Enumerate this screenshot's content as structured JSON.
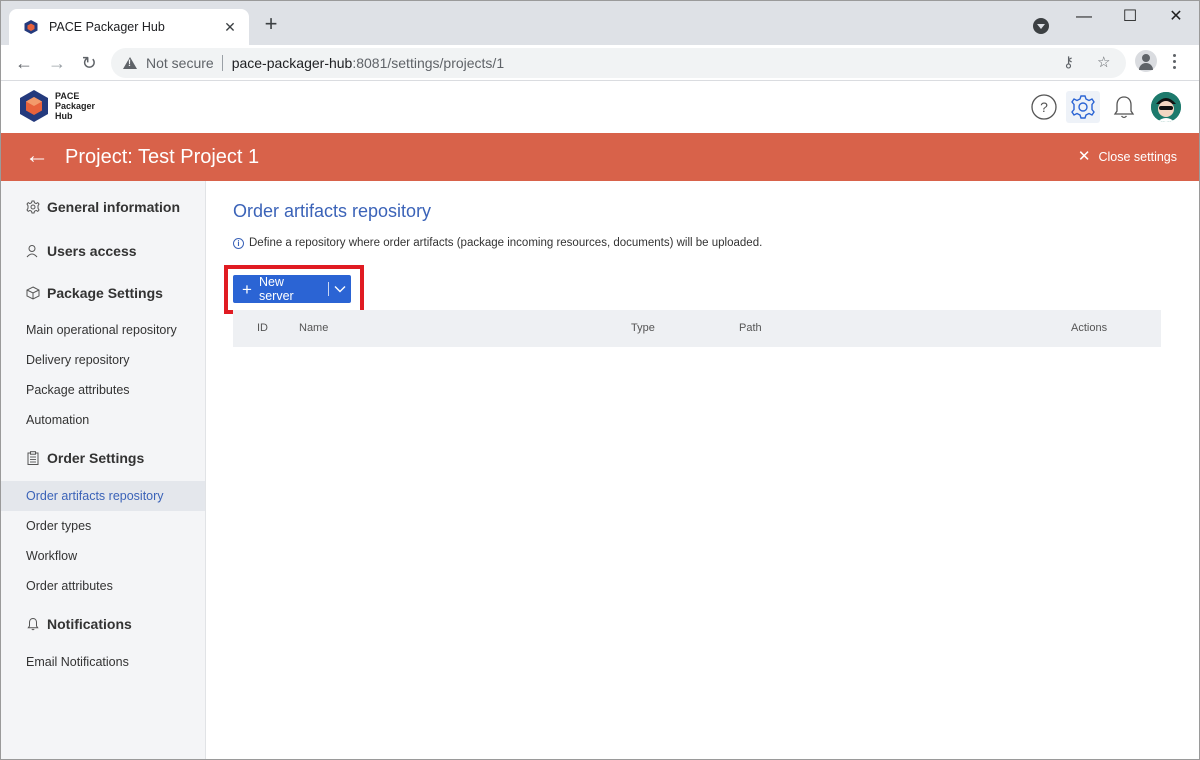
{
  "browser": {
    "tab_title": "PACE Packager Hub",
    "new_tab_glyph": "+",
    "close_tab_glyph": "✕",
    "minimize_glyph": "—",
    "maximize_glyph": "☐",
    "close_glyph": "✕",
    "back_glyph": "←",
    "forward_glyph": "→",
    "reload_glyph": "↻",
    "security_label": "Not secure",
    "url_host": "pace-packager-hub",
    "url_rest": ":8081/settings/projects/1",
    "key_glyph": "⚷",
    "star_glyph": "☆"
  },
  "app": {
    "logo_line1": "PACE",
    "logo_line2": "Packager",
    "logo_line3": "Hub",
    "help_glyph": "?",
    "accent_color": "#d8624a",
    "primary_color": "#2b64d4"
  },
  "banner": {
    "back_glyph": "←",
    "title": "Project: Test Project 1",
    "close_glyph": "✕",
    "close_label": "Close settings"
  },
  "sidebar": {
    "sections": [
      {
        "label": "General information",
        "icon": "gear-icon"
      },
      {
        "label": "Users access",
        "icon": "user-icon"
      },
      {
        "label": "Package Settings",
        "icon": "package-icon"
      },
      {
        "label": "Order Settings",
        "icon": "clipboard-icon"
      },
      {
        "label": "Notifications",
        "icon": "bell-icon"
      }
    ],
    "package_items": [
      "Main operational repository",
      "Delivery repository",
      "Package attributes",
      "Automation"
    ],
    "order_items": [
      "Order artifacts repository",
      "Order types",
      "Workflow",
      "Order attributes"
    ],
    "notification_items": [
      "Email Notifications"
    ],
    "active_item": "Order artifacts repository"
  },
  "main": {
    "title": "Order artifacts repository",
    "info_glyph": "i",
    "info_text": "Define a repository where order artifacts (package incoming resources, documents) will be uploaded.",
    "new_server_plus": "+",
    "new_server_label": "New server",
    "table_headers": [
      "ID",
      "Name",
      "Type",
      "Path",
      "Actions"
    ]
  }
}
